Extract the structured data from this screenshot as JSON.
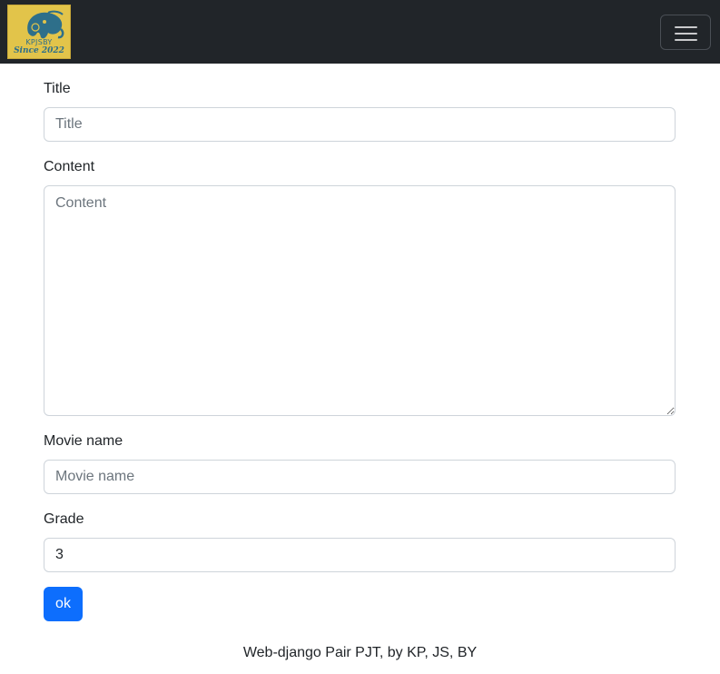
{
  "navbar": {
    "logo_text_line1": "KPJSBY",
    "logo_text_line2": "Since 2022",
    "toggle_icon": "hamburger-menu-icon"
  },
  "form": {
    "title_label": "Title",
    "title_placeholder": "Title",
    "title_value": "",
    "content_label": "Content",
    "content_placeholder": "Content",
    "content_value": "",
    "movie_label": "Movie name",
    "movie_placeholder": "Movie name",
    "movie_value": "",
    "grade_label": "Grade",
    "grade_value": "3",
    "submit_label": "ok"
  },
  "footer": {
    "text": "Web-django Pair PJT, by KP, JS, BY"
  },
  "colors": {
    "navbar_bg": "#212529",
    "primary": "#0d6efd",
    "logo_bg": "#e2c44a"
  }
}
